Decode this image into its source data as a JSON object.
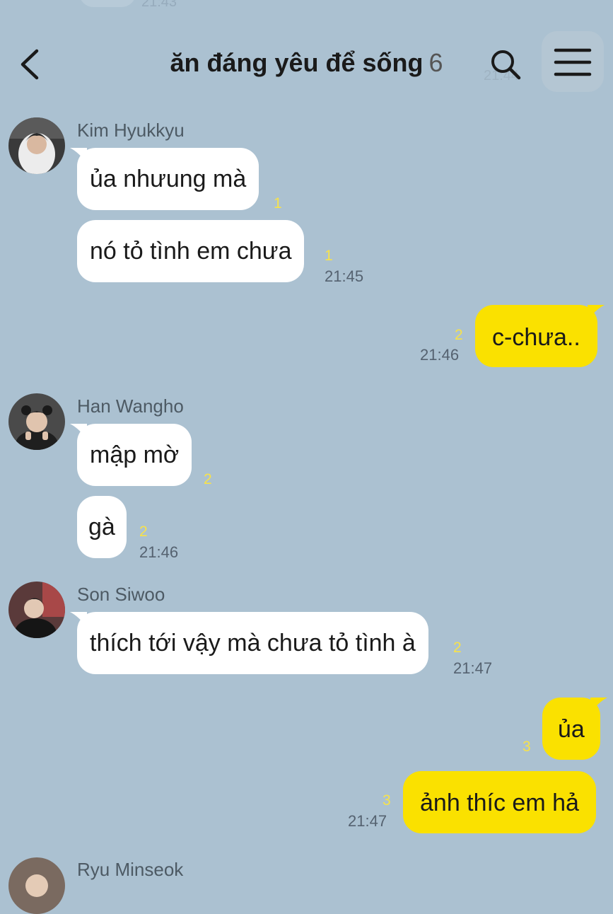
{
  "header": {
    "title": "ăn đáng yêu để sống",
    "member_count": "6",
    "icons": [
      "back-icon",
      "search-icon",
      "menu-icon"
    ]
  },
  "ghost": {
    "top_time": "21:43",
    "header_time": "21:44"
  },
  "colors": {
    "background": "#abc1d1",
    "my_bubble": "#fae100",
    "other_bubble": "#ffffff",
    "unread": "#f7e24a"
  },
  "messages": {
    "kim": {
      "name": "Kim Hyukkyu",
      "m1": "ủa nhưung mà",
      "m1_unread": "1",
      "m2": "nó tỏ tình em chưa",
      "m2_unread": "1",
      "time": "21:45"
    },
    "me1": {
      "text": "c-chưa..",
      "unread": "2",
      "time": "21:46"
    },
    "han": {
      "name": "Han Wangho",
      "m1": "mập mờ",
      "m1_unread": "2",
      "m2": "gà",
      "m2_unread": "2",
      "time": "21:46"
    },
    "son": {
      "name": "Son Siwoo",
      "m1": "thích tới vậy mà chưa tỏ tình à",
      "m1_unread": "2",
      "time": "21:47"
    },
    "me2": {
      "m1": "ủa",
      "m1_unread": "3",
      "m2": "ảnh thíc em hả",
      "m2_unread": "3",
      "time": "21:47"
    },
    "next": {
      "name": "Ryu Minseok"
    }
  }
}
